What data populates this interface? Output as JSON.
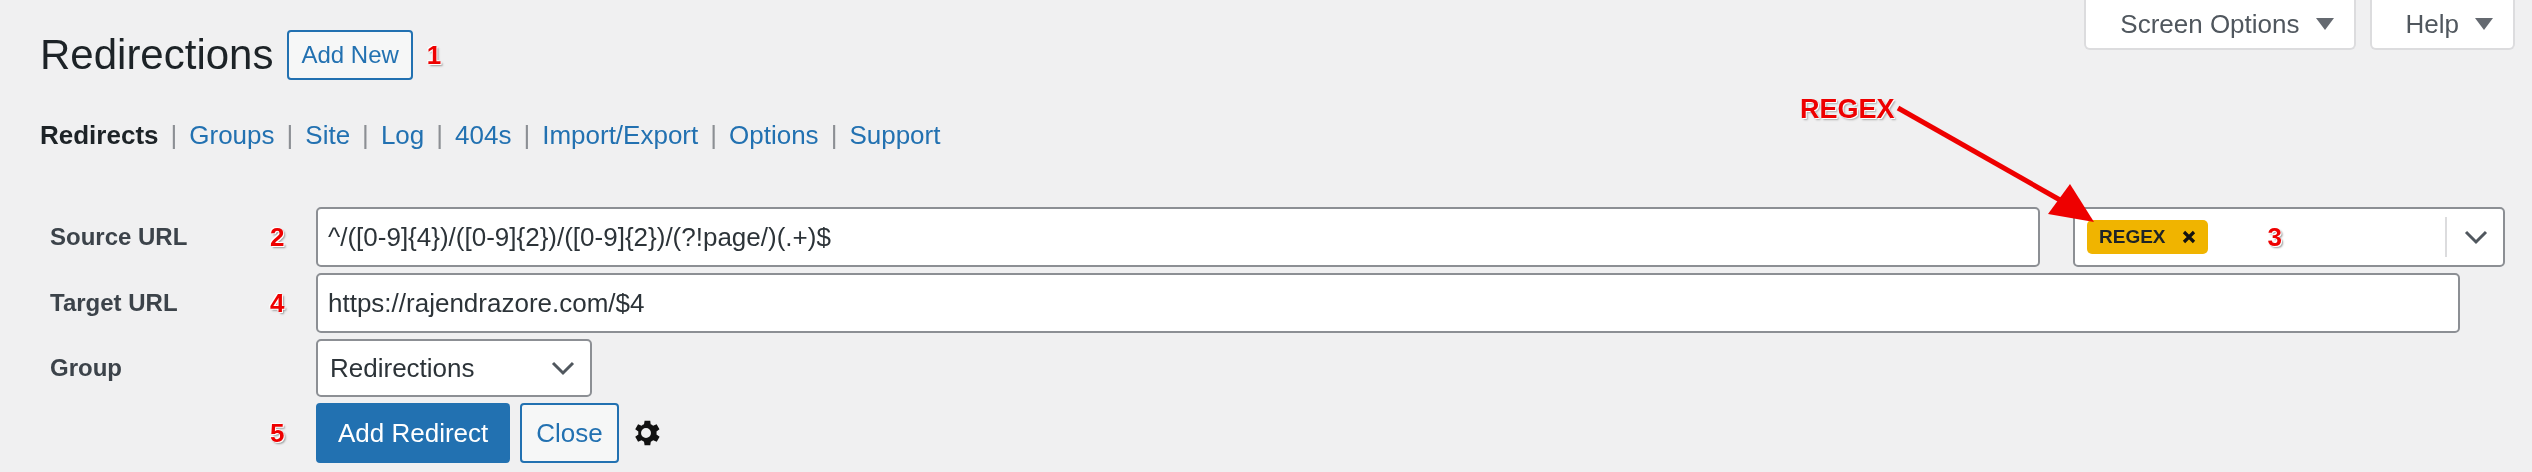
{
  "screen_meta": [
    {
      "label": "Screen Options"
    },
    {
      "label": "Help"
    }
  ],
  "header": {
    "title": "Redirections",
    "add_new": "Add New",
    "marker": "1"
  },
  "nav": [
    {
      "label": "Redirects",
      "selected": true
    },
    {
      "separator": "|",
      "label": "Groups",
      "selected": false
    },
    {
      "separator": "|",
      "label": "Site",
      "selected": false
    },
    {
      "separator": "|",
      "label": "Log",
      "selected": false
    },
    {
      "separator": "|",
      "label": "404s",
      "selected": false
    },
    {
      "separator": "|",
      "label": "Import/Export",
      "selected": false
    },
    {
      "separator": "|",
      "label": "Options",
      "selected": false
    },
    {
      "separator": "|",
      "label": "Support",
      "selected": false
    }
  ],
  "form": {
    "rows": [
      {
        "kind": "source",
        "label": "Source URL",
        "marker": "2",
        "value": "^/([0-9]{4})/([0-9]{2})/([0-9]{2})/(?!page/)(.+)$",
        "flag": "REGEX",
        "flag_marker": "3"
      },
      {
        "kind": "target",
        "label": "Target URL",
        "marker": "4",
        "value": "https://rajendrazore.com/$4"
      },
      {
        "kind": "select",
        "label": "Group",
        "value": "Redirections"
      }
    ],
    "actions": {
      "marker": "5",
      "primary": "Add Redirect",
      "secondary": "Close"
    }
  },
  "callout": {
    "text": "REGEX"
  }
}
